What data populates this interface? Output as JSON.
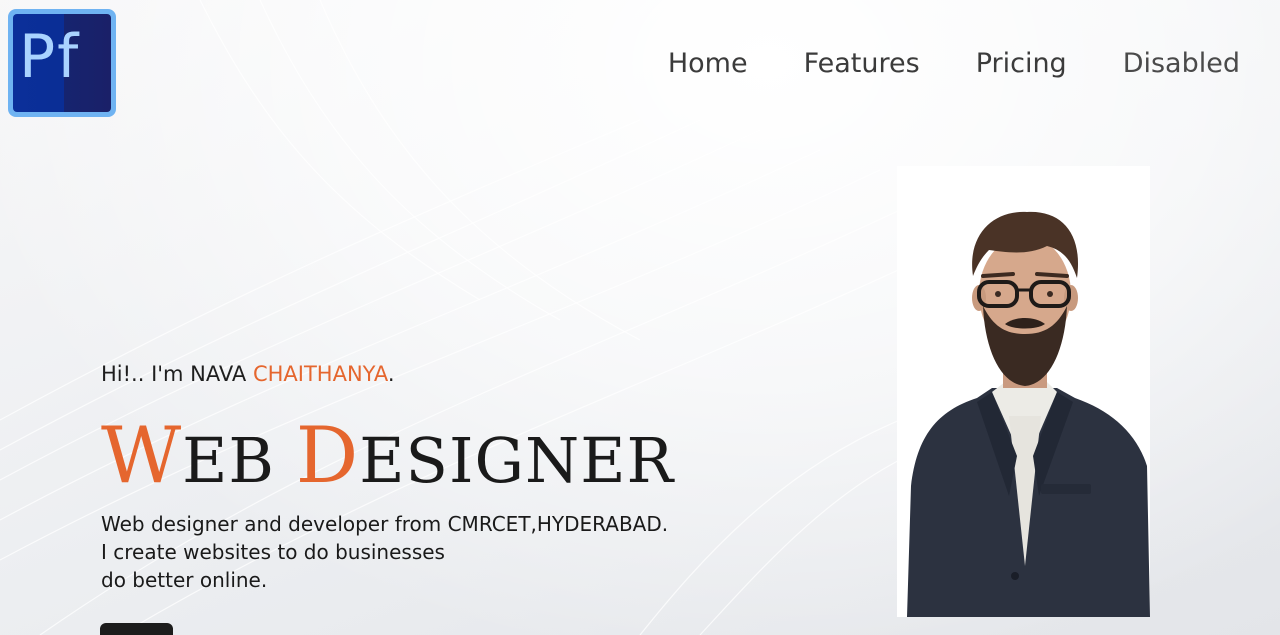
{
  "logo": {
    "text": "Pf"
  },
  "nav": {
    "items": [
      {
        "label": "Home"
      },
      {
        "label": "Features"
      },
      {
        "label": "Pricing"
      },
      {
        "label": "Disabled"
      }
    ]
  },
  "hero": {
    "greeting_prefix": "Hi!.. I'm NAVA ",
    "greeting_name": "CHAITHANYA",
    "greeting_suffix": ".",
    "title_w": "W",
    "title_eb": "EB ",
    "title_d": "D",
    "title_esigner": "ESIGNER",
    "desc_lines": [
      "Web designer and developer from CMRCET,HYDERABAD.",
      "I create websites to do businesses",
      "do better online."
    ]
  },
  "colors": {
    "accent": "#e5662e",
    "text": "#1a1a1a",
    "logo_border": "#6fb3f2",
    "logo_bg": "#0b2f9a"
  }
}
